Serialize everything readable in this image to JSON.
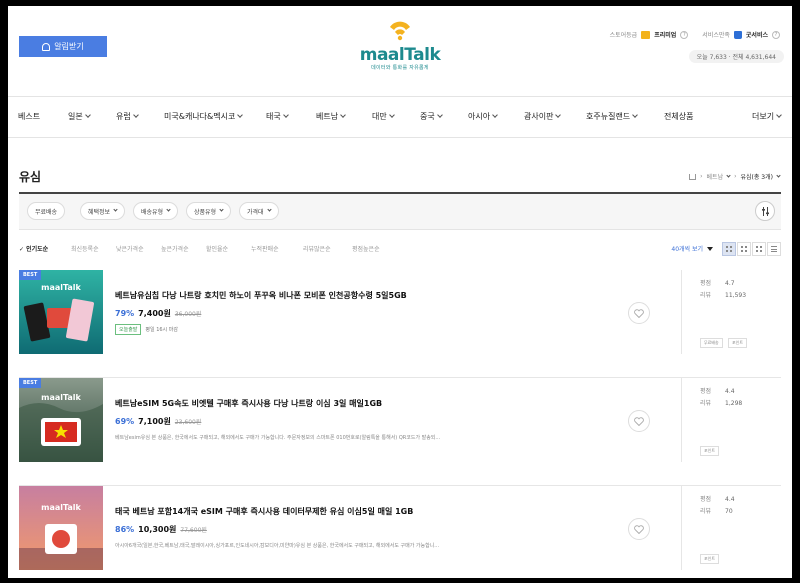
{
  "header": {
    "alarm_label": "알림받기",
    "logo_text": "maalTalk",
    "logo_sub": "데이터와 통화를 자유롭게",
    "store_grade_label": "스토어등급",
    "store_grade_value": "프리미엄",
    "service_label": "서비스만족",
    "service_value": "굿서비스",
    "visitors": "오늘 7,633 · 전체 4,631,644"
  },
  "nav": {
    "items": [
      {
        "label": "베스트",
        "dropdown": false
      },
      {
        "label": "일본",
        "dropdown": true
      },
      {
        "label": "유럽",
        "dropdown": true
      },
      {
        "label": "미국&캐나다&멕시코",
        "dropdown": true
      },
      {
        "label": "태국",
        "dropdown": true
      },
      {
        "label": "베트남",
        "dropdown": true
      },
      {
        "label": "대만",
        "dropdown": true
      },
      {
        "label": "중국",
        "dropdown": true
      },
      {
        "label": "아시아",
        "dropdown": true
      },
      {
        "label": "괌사이판",
        "dropdown": true
      },
      {
        "label": "호주뉴질랜드",
        "dropdown": true
      },
      {
        "label": "전체상품",
        "dropdown": false
      },
      {
        "label": "더보기",
        "dropdown": true
      }
    ]
  },
  "page": {
    "title": "유심",
    "breadcrumb": [
      "베트남",
      "유심(총 3개)"
    ]
  },
  "filters": [
    "무료배송",
    "혜택정보",
    "배송유형",
    "상품유형",
    "가격대"
  ],
  "sort": {
    "items": [
      "인기도순",
      "최신등록순",
      "낮은가격순",
      "높은가격순",
      "할인율순",
      "누적판매순",
      "리뷰많은순",
      "평점높은순"
    ],
    "per_page": "40개씩 보기"
  },
  "products": [
    {
      "badge": "BEST",
      "title": "베트남유심칩 다낭 나트랑 호치민 하노이 푸꾸옥 비나폰 모비폰 인천공항수령 5일5GB",
      "discount": "79%",
      "price": "7,400원",
      "original": "36,000원",
      "tag": "오늘출발",
      "tag_note": "평일 16시 마감",
      "description": "",
      "rating_label": "평점",
      "rating": "4.7",
      "review_label": "리뷰",
      "reviews": "11,593",
      "chips": [
        "무료배송",
        "포인트"
      ]
    },
    {
      "badge": "BEST",
      "title": "베트남eSIM 5G속도 비엣텔 구매후 즉시사용 다낭 나트랑 이심 3일 매일1GB",
      "discount": "69%",
      "price": "7,100원",
      "original": "23,600원",
      "tag": "",
      "tag_note": "",
      "description": "베트남esim유심 본 상품은, 한국에서도 구매되고, 해외에서도 구매가 가능합니다. 주문자정보의 스마트폰 010번호로(알림톡을 통해서) QR코드가 발송되...",
      "rating_label": "평점",
      "rating": "4.4",
      "review_label": "리뷰",
      "reviews": "1,298",
      "chips": [
        "포인트"
      ]
    },
    {
      "badge": "",
      "title": "태국 베트남 포함14개국 eSIM 구매후 즉시사용 데이터무제한 유심 이심5일 매일 1GB",
      "discount": "86%",
      "price": "10,300원",
      "original": "77,600원",
      "tag": "",
      "tag_note": "",
      "description": "아시아6개국(일본,한국,베트남,태국,말레이시아,싱가포르,인도네시아,캄보디아,미얀마)유심 본 상품은, 한국에서도 구매되고, 해외에서도 구매가 가능합니...",
      "rating_label": "평점",
      "rating": "4.4",
      "review_label": "리뷰",
      "reviews": "70",
      "chips": [
        "포인트"
      ]
    }
  ],
  "colors": {
    "accent": "#4a7de2",
    "brand": "#1d8a8e",
    "logo_yellow": "#f4b21f",
    "discount_blue": "#3b6fd6"
  }
}
